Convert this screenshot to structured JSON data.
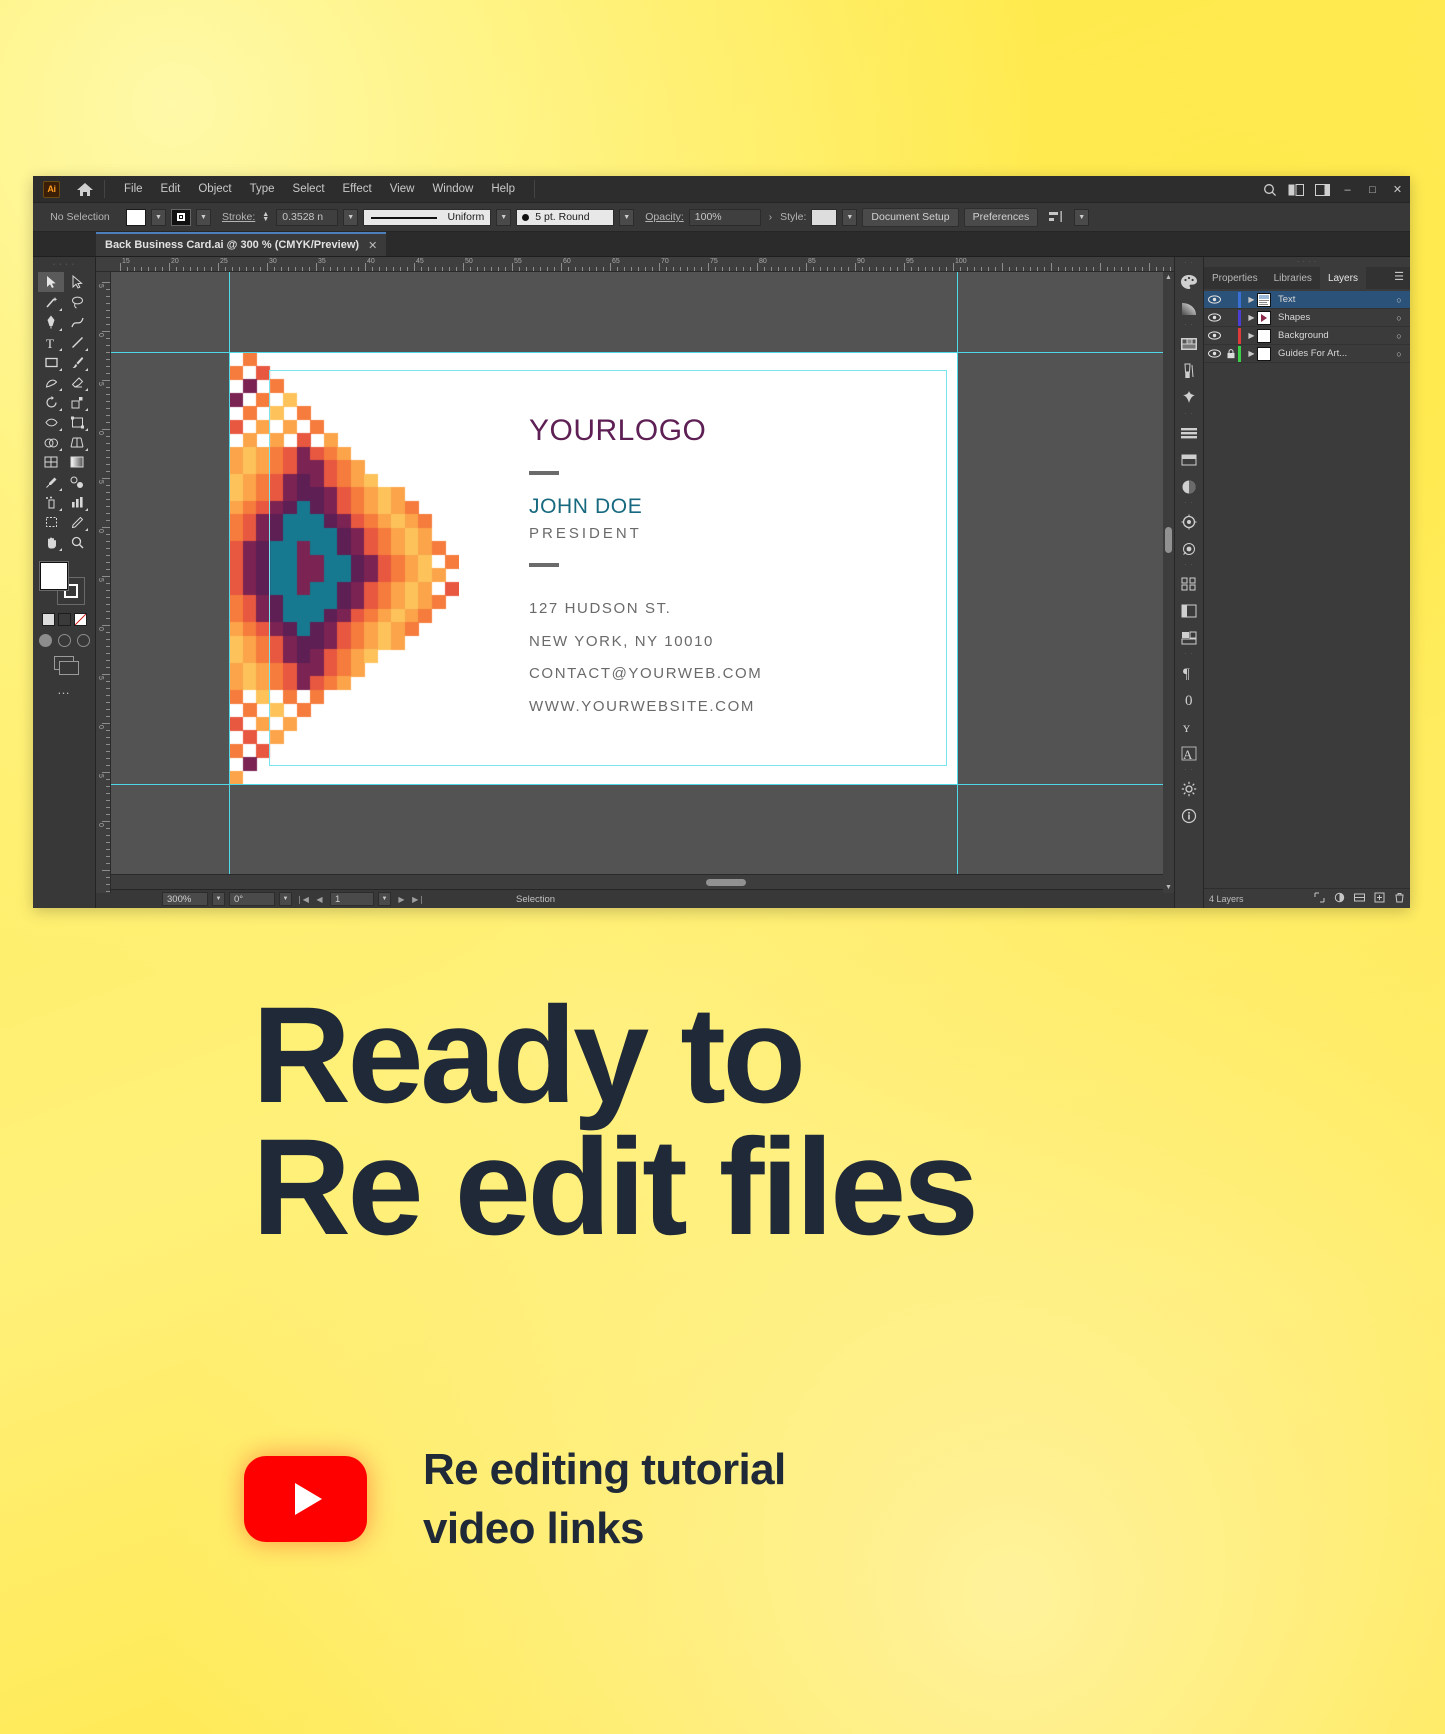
{
  "app": {
    "logo_text": "Ai",
    "home_icon": "home-icon",
    "menus": [
      "File",
      "Edit",
      "Object",
      "Type",
      "Select",
      "Effect",
      "View",
      "Window",
      "Help"
    ],
    "window_controls": {
      "minimize": "–",
      "maximize": "□",
      "close": "✕"
    },
    "search_icon": "search-icon",
    "arrange_icon": "arrange-documents-icon",
    "workspace_icon": "workspace-switcher-icon"
  },
  "control_bar": {
    "selection_status": "No Selection",
    "fill_swatch": "#ffffff",
    "stroke_swatch": "#000000",
    "stroke_label": "Stroke:",
    "stroke_weight": "0.3528 n",
    "stroke_profile": "Uniform",
    "brush_definition": "5 pt. Round",
    "opacity_label": "Opacity:",
    "opacity_value": "100%",
    "style_label": "Style:",
    "document_setup": "Document Setup",
    "preferences": "Preferences"
  },
  "document_tab": {
    "title": "Back Business Card.ai @ 300 % (CMYK/Preview)",
    "close": "✕"
  },
  "tools": [
    "selection-tool",
    "direct-selection-tool",
    "magic-wand-tool",
    "lasso-tool",
    "pen-tool",
    "curvature-tool",
    "type-tool",
    "line-segment-tool",
    "rectangle-tool",
    "paintbrush-tool",
    "shaper-tool",
    "eraser-tool",
    "rotate-tool",
    "scale-tool",
    "width-tool",
    "free-transform-tool",
    "shape-builder-tool",
    "perspective-grid-tool",
    "mesh-tool",
    "gradient-tool",
    "eyedropper-tool",
    "blend-tool",
    "symbol-sprayer-tool",
    "column-graph-tool",
    "artboard-tool",
    "slice-tool",
    "hand-tool",
    "zoom-tool"
  ],
  "tool_panel": {
    "fill_color": "#ffffff",
    "stroke_color": "#ffffff",
    "swatches": [
      "color-swatch",
      "gradient-swatch",
      "none-swatch"
    ],
    "drawing_modes": [
      "draw-normal",
      "draw-behind",
      "draw-inside"
    ],
    "screen_mode": "screen-mode-icon",
    "more_tools": "…"
  },
  "canvas": {
    "ruler_units_top": [
      "15",
      "20",
      "25",
      "30",
      "35",
      "40",
      "45",
      "50",
      "55",
      "60",
      "65",
      "70",
      "75",
      "80",
      "85",
      "90",
      "95",
      "100"
    ],
    "ruler_units_left": [
      "5",
      "0",
      "5",
      "0",
      "5",
      "0",
      "5",
      "0",
      "5",
      "0",
      "5",
      "0"
    ],
    "guide_color": "#4fd8e8"
  },
  "business_card": {
    "logo": "YOURLOGO",
    "logo_color": "#5d1f54",
    "name": "JOHN DOE",
    "name_color": "#17697f",
    "role": "PRESIDENT",
    "address_lines": [
      "127 HUDSON ST.",
      "NEW YORK, NY 10010",
      "CONTACT@YOURWEB.COM",
      "WWW.YOURWEBSITE.COM"
    ],
    "body_color": "#6a6a6a",
    "art_palette": [
      "#16798f",
      "#5d1f54",
      "#7b2352",
      "#e8573f",
      "#f57c3c",
      "#fba44a",
      "#fdc25a"
    ]
  },
  "status_bar": {
    "zoom": "300%",
    "rotation": "0°",
    "artboard_number": "1",
    "nav_first": "❘◀",
    "nav_prev": "◀",
    "nav_next": "▶",
    "nav_last": "▶❘",
    "status_text": "Selection"
  },
  "right_rail": [
    "color-panel-icon",
    "gradient-panel-icon",
    "swatches-panel-icon",
    "brushes-panel-icon",
    "symbols-panel-icon",
    "align-panel-icon",
    "pathfinder-panel-icon",
    "transparency-panel-icon",
    "appearance-panel-icon",
    "graphic-styles-panel-icon",
    "artboards-panel-icon",
    "asset-export-panel-icon",
    "transform-panel-icon",
    "align-objects-icon",
    "pathfinder-icon",
    "paragraph-panel-icon",
    "glyphs-panel-icon",
    "character-panel-icon",
    "character-styles-panel-icon",
    "properties-gear-icon",
    "document-info-icon"
  ],
  "layers_panel": {
    "tabs": [
      "Properties",
      "Libraries",
      "Layers"
    ],
    "active_tab": "Layers",
    "menu_icon": "panel-menu-icon",
    "layers": [
      {
        "name": "Text",
        "color": "#3b6fd4",
        "visible": true,
        "locked": false,
        "selected": true
      },
      {
        "name": "Shapes",
        "color": "#4a3fd2",
        "visible": true,
        "locked": false,
        "selected": false
      },
      {
        "name": "Background",
        "color": "#e03b3b",
        "visible": true,
        "locked": false,
        "selected": false
      },
      {
        "name": "Guides For Art...",
        "color": "#3ccf48",
        "visible": true,
        "locked": true,
        "selected": false
      }
    ],
    "footer_count": "4 Layers",
    "footer_icons": [
      "locate-object-icon",
      "make-clipping-mask-icon",
      "create-sublayer-icon",
      "new-layer-icon",
      "delete-selection-icon"
    ]
  },
  "promo": {
    "line1": "Ready to",
    "line2": "Re edit files",
    "youtube_icon": "youtube-play-icon",
    "cta_line1": "Re editing tutorial",
    "cta_line2": "video links",
    "accent_color": "#ff0000",
    "text_color": "#1f2937"
  }
}
